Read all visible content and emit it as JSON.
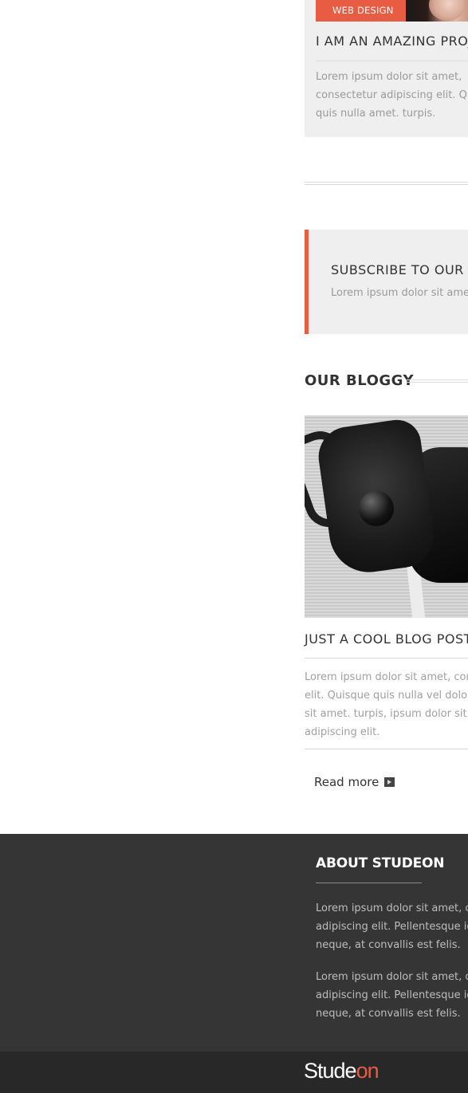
{
  "portfolio": {
    "tag": "WEB DESIGN",
    "title": "I AM AN AMAZING PROJ",
    "text_lines": [
      "Lorem ipsum dolor sit amet,",
      "consectetur adipiscing elit. Quis",
      "quis nulla amet. turpis."
    ]
  },
  "subscribe": {
    "title": "SUBSCRIBE TO OUR NE",
    "text": "Lorem ipsum dolor sit amet"
  },
  "blog": {
    "heading": "OUR BLOGGY",
    "post": {
      "title": "JUST A COOL BLOG POST T",
      "text_lines": [
        "Lorem ipsum dolor sit amet, cons",
        "elit. Quisque quis nulla vel dolor u",
        "sit amet. turpis, ipsum dolor sit a",
        "adipiscing elit."
      ],
      "read_more": "Read more"
    }
  },
  "footer": {
    "about_title": "ABOUT STUDEON",
    "paragraph_1": [
      "Lorem ipsum dolor sit amet, co",
      "adipiscing elit. Pellentesque id",
      "neque, at convallis est felis."
    ],
    "paragraph_2": [
      "Lorem ipsum dolor sit amet, co",
      "adipiscing elit. Pellentesque id",
      "neque, at convallis est felis."
    ],
    "logo_part_1": "Stude",
    "logo_part_2": "on"
  },
  "colors": {
    "accent": "#e85c44",
    "footer_bg": "#353535",
    "bottom_bar_bg": "#282828"
  }
}
